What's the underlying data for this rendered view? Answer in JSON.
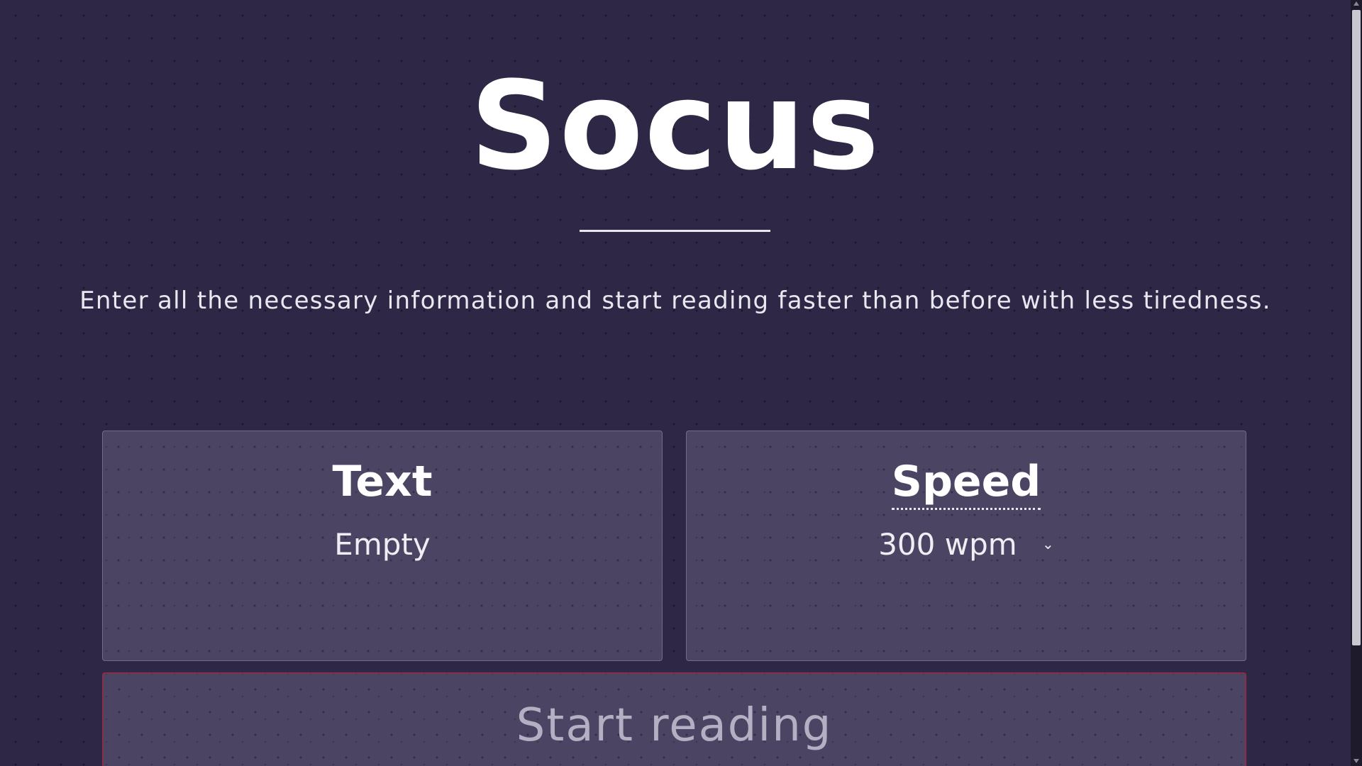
{
  "header": {
    "title": "Socus",
    "subtitle": "Enter all the necessary information and start reading faster than before with less tiredness."
  },
  "cards": {
    "text": {
      "heading": "Text",
      "value": "Empty"
    },
    "speed": {
      "heading": "Speed",
      "value": "300 wpm",
      "chevron": "⌄"
    }
  },
  "actions": {
    "start_label": "Start reading"
  },
  "colors": {
    "background": "#2e2846",
    "card": "#5a506d",
    "start_border": "#a02846",
    "start_text": "#b5afc3"
  },
  "icons": {
    "speed_dropdown": "chevron-down-icon"
  }
}
